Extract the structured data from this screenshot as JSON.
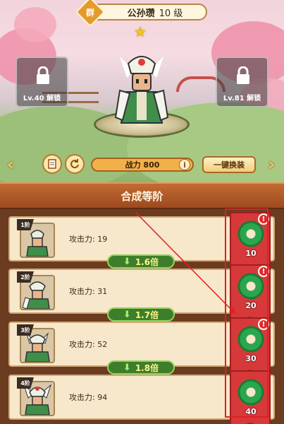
{
  "hero": {
    "faction": "群",
    "name": "公孙瓒",
    "level": "10 级",
    "stars": 1
  },
  "locks": {
    "left": "Lv.40 解锁",
    "right": "Lv.81 解锁"
  },
  "toolbar": {
    "power": "战力 800",
    "info": "i",
    "swap": "一键换装"
  },
  "section": {
    "title": "合成等阶"
  },
  "tiers": [
    {
      "rank": "1阶",
      "attack": "攻击力: 19",
      "jade": "10"
    },
    {
      "rank": "2阶",
      "attack": "攻击力: 31",
      "jade": "20"
    },
    {
      "rank": "3阶",
      "attack": "攻击力: 52",
      "jade": "30"
    },
    {
      "rank": "4阶",
      "attack": "攻击力: 94",
      "jade": "40"
    }
  ],
  "multipliers": [
    "1.6倍",
    "1.7倍",
    "1.8倍"
  ],
  "alert_symbol": "!",
  "colors": {
    "panel_bg": "#6b3c1f",
    "row_bg": "#f7e7cb",
    "banner": "#d7393a",
    "jade": "#2aa64e",
    "multiplier": "#3e7e2a"
  }
}
